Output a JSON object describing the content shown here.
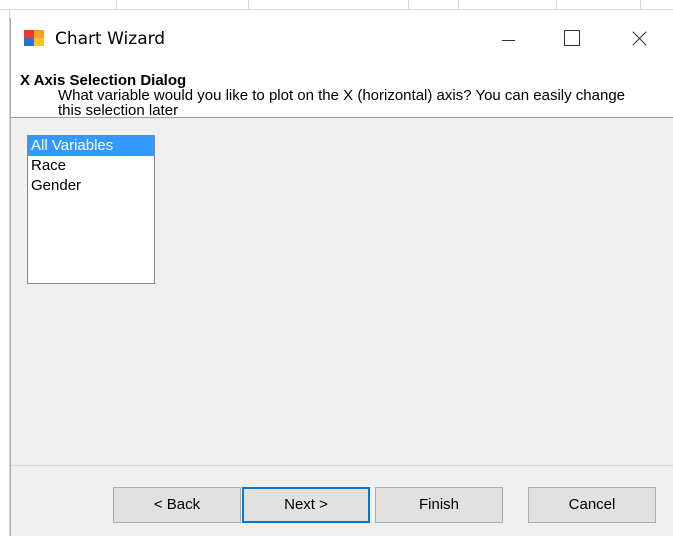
{
  "window": {
    "title": "Chart Wizard"
  },
  "header": {
    "heading": "X Axis Selection Dialog",
    "description": "What variable would you like to plot on the X (horizontal) axis? You can easily change this selection later"
  },
  "variables": {
    "items": [
      "All Variables",
      "Race",
      "Gender"
    ],
    "selected": "All Variables"
  },
  "buttons": {
    "back": "< Back",
    "next": "Next >",
    "finish": "Finish",
    "cancel": "Cancel"
  },
  "colors": {
    "selection": "#3399ff",
    "default_button_border": "#0078d7"
  }
}
